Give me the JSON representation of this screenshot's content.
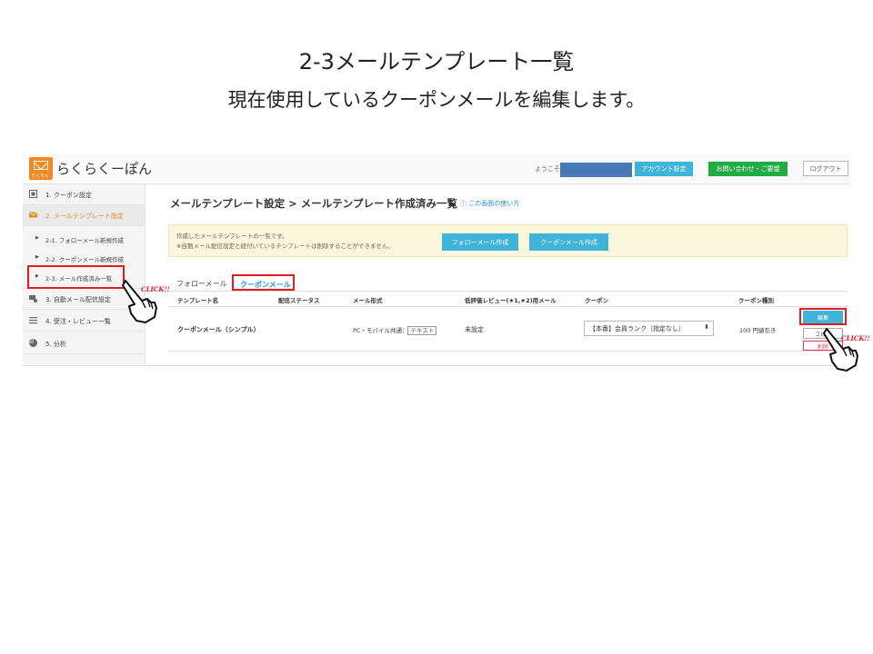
{
  "slide": {
    "title": "2-3メールテンプレート一覧",
    "subtitle": "現在使用しているクーポンメールを編集します。"
  },
  "header": {
    "logo_tag": "らくらく",
    "logo_text": "らくらくーぽん",
    "welcome": "ようこそ",
    "account_button": "アカウント設定",
    "contact_button": "お問い合わせ・ご要望",
    "logout_button": "ログアウト"
  },
  "sidebar": {
    "items": [
      {
        "label": "1. クーポン設定"
      },
      {
        "label": "2. メールテンプレート設定"
      },
      {
        "label": "3. 自動メール配信設定"
      },
      {
        "label": "4. 受注・レビュー一覧"
      },
      {
        "label": "5. 分析"
      }
    ],
    "sub_items": [
      {
        "label": "2-1. フォローメール新規作成"
      },
      {
        "label": "2-2. クーポンメール新規作成"
      },
      {
        "label": "2-3. メール作成済み一覧"
      }
    ]
  },
  "main": {
    "page_title": "メールテンプレート設定 > メールテンプレート作成済み一覧",
    "help_link": "この画面の使い方",
    "notice_line1": "作成したメールテンプレートの一覧です。",
    "notice_line2": "※自動メール配信設定と紐付いているテンプレートは削除することができません。",
    "follow_create_button": "フォローメール作成",
    "coupon_create_button": "クーポンメール作成",
    "tab_follow": "フォローメール",
    "tab_coupon": "クーポンメール"
  },
  "table": {
    "headers": [
      "テンプレート名",
      "配信ステータス",
      "メール形式",
      "低評価レビュー(★1,★2)用メール",
      "クーポン",
      "クーポン種別"
    ],
    "row": {
      "name": "クーポンメール（シンプル）",
      "format": "PC・モバイル共通：",
      "format_badge": "テキスト",
      "low_review": "未設定",
      "coupon": "【本番】会員ランク（指定なし）",
      "coupon_type": "100 円値引き",
      "edit_button": "編集",
      "copy_button": "コピー",
      "delete_button": "削除"
    }
  },
  "annotations": {
    "click1": "CLICK!!",
    "click2": "CLICK!!"
  },
  "colors": {
    "accent_blue": "#3fb3d8",
    "green": "#22aa44",
    "highlight_red": "#e31b23",
    "logo_orange": "#f08a24"
  }
}
